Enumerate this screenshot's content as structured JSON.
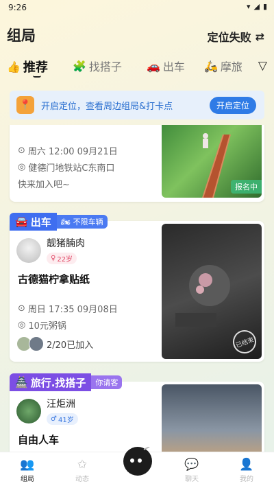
{
  "status_bar": {
    "time": "9:26"
  },
  "header": {
    "title": "组局",
    "location_label": "定位失败"
  },
  "tabs": [
    {
      "label": "推荐",
      "icon": "thumbs-up-icon"
    },
    {
      "label": "找搭子",
      "icon": "puzzle-icon"
    },
    {
      "label": "出车",
      "icon": "car-icon"
    },
    {
      "label": "摩旅",
      "icon": "scooter-icon"
    }
  ],
  "banner": {
    "text": "开启定位，查看周边组局&打卡点",
    "button": "开启定位"
  },
  "cards": [
    {
      "datetime": "周六 12:00 09月21日",
      "place": "健德门地铁站C东南口",
      "desc": "快来加入吧~",
      "status": "报名中"
    },
    {
      "tag": "出车",
      "tag_sub": "不限车辆",
      "author": "靓猪腩肉",
      "age": "22岁",
      "title": "古德猫柠拿贴纸",
      "datetime": "周日 17:35 09月08日",
      "place": "10元粥锅",
      "joined": "2/20已加入",
      "stamp": "已结束"
    },
    {
      "tag": "旅行.找搭子",
      "tag_sub": "你请客",
      "author": "汪炬洲",
      "age": "41岁",
      "title": "自由人车"
    }
  ],
  "bottom_nav": [
    {
      "label": "组局",
      "icon": "group-icon"
    },
    {
      "label": "动态",
      "icon": "star-icon"
    },
    {
      "label": "聊天",
      "icon": "chat-icon"
    },
    {
      "label": "我的",
      "icon": "profile-icon"
    }
  ],
  "colors": {
    "accent_blue": "#2f7be6",
    "tag_blue": "#3f6ef0",
    "tag_purple": "#7c4ee4",
    "status_green": "#3cb878"
  }
}
